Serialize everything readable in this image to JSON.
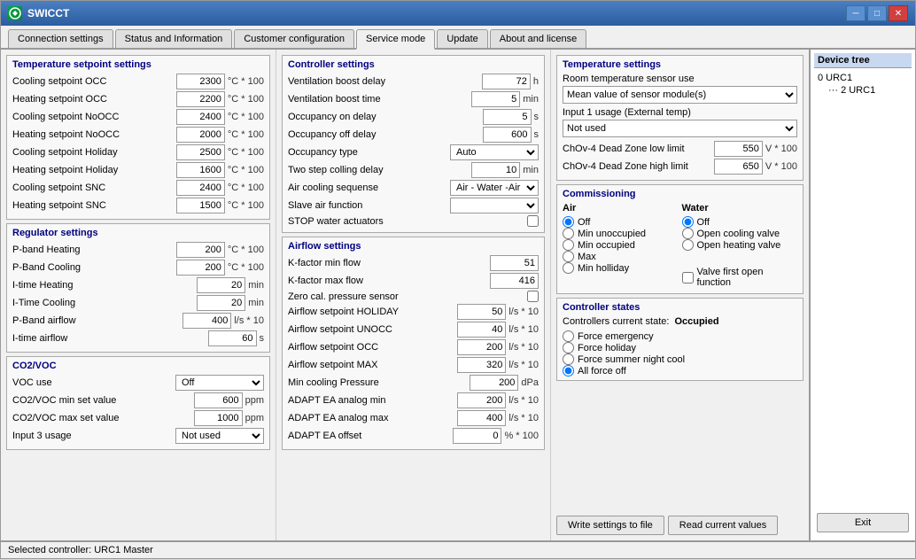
{
  "window": {
    "title": "SWICCT",
    "icon": "SW"
  },
  "tabs": [
    {
      "label": "Connection settings",
      "active": false
    },
    {
      "label": "Status and Information",
      "active": false
    },
    {
      "label": "Customer configuration",
      "active": false
    },
    {
      "label": "Service mode",
      "active": true
    },
    {
      "label": "Update",
      "active": false
    },
    {
      "label": "About and license",
      "active": false
    }
  ],
  "device_tree": {
    "title": "Device tree",
    "nodes": [
      {
        "label": "0 URC1",
        "level": 1
      },
      {
        "label": "2 URC1",
        "level": 2
      }
    ]
  },
  "temperature_setpoints": {
    "title": "Temperature setpoint settings",
    "fields": [
      {
        "label": "Cooling setpoint OCC",
        "value": "2300",
        "unit": "°C * 100"
      },
      {
        "label": "Heating setpoint OCC",
        "value": "2200",
        "unit": "°C * 100"
      },
      {
        "label": "Cooling setpoint NoOCC",
        "value": "2400",
        "unit": "°C * 100"
      },
      {
        "label": "Heating setpoint NoOCC",
        "value": "2000",
        "unit": "°C * 100"
      },
      {
        "label": "Cooling setpoint Holiday",
        "value": "2500",
        "unit": "°C * 100"
      },
      {
        "label": "Heating setpoint Holiday",
        "value": "1600",
        "unit": "°C * 100"
      },
      {
        "label": "Cooling setpoint SNC",
        "value": "2400",
        "unit": "°C * 100"
      },
      {
        "label": "Heating setpoint SNC",
        "value": "1500",
        "unit": "°C * 100"
      }
    ]
  },
  "regulator_settings": {
    "title": "Regulator settings",
    "fields": [
      {
        "label": "P-band Heating",
        "value": "200",
        "unit": "°C * 100"
      },
      {
        "label": "P-Band Cooling",
        "value": "200",
        "unit": "°C * 100"
      },
      {
        "label": "I-time Heating",
        "value": "20",
        "unit": "min"
      },
      {
        "label": "I-Time Cooling",
        "value": "20",
        "unit": "min"
      },
      {
        "label": "P-Band airflow",
        "value": "400",
        "unit": "l/s * 10"
      },
      {
        "label": "I-time airflow",
        "value": "60",
        "unit": "s"
      }
    ]
  },
  "co2_voc": {
    "title": "CO2/VOC",
    "fields": [
      {
        "label": "VOC use",
        "value": "Off",
        "type": "dropdown"
      },
      {
        "label": "CO2/VOC min set value",
        "value": "600",
        "unit": "ppm"
      },
      {
        "label": "CO2/VOC max set value",
        "value": "1000",
        "unit": "ppm"
      },
      {
        "label": "Input 3 usage",
        "value": "Not used",
        "type": "dropdown"
      }
    ]
  },
  "controller_settings": {
    "title": "Controller settings",
    "fields": [
      {
        "label": "Ventilation boost delay",
        "value": "72",
        "unit": "h"
      },
      {
        "label": "Ventilation boost time",
        "value": "5",
        "unit": "min"
      },
      {
        "label": "Occupancy on delay",
        "value": "5",
        "unit": "s"
      },
      {
        "label": "Occupancy off delay",
        "value": "600",
        "unit": "s"
      },
      {
        "label": "Occupancy type",
        "value": "Auto",
        "type": "dropdown"
      },
      {
        "label": "Two step colling delay",
        "value": "10",
        "unit": "min"
      },
      {
        "label": "Air cooling sequense",
        "value": "Air - Water -Air",
        "type": "dropdown"
      },
      {
        "label": "Slave air function",
        "value": "",
        "type": "dropdown"
      },
      {
        "label": "STOP water actuators",
        "value": false,
        "type": "checkbox"
      }
    ]
  },
  "airflow_settings": {
    "title": "Airflow settings",
    "fields": [
      {
        "label": "K-factor min flow",
        "value": "51"
      },
      {
        "label": "K-factor max flow",
        "value": "416"
      },
      {
        "label": "Zero cal. pressure sensor",
        "value": false,
        "type": "checkbox"
      },
      {
        "label": "Airflow setpoint HOLIDAY",
        "value": "50",
        "unit": "l/s * 10"
      },
      {
        "label": "Airflow setpoint UNOCC",
        "value": "40",
        "unit": "l/s * 10"
      },
      {
        "label": "Airflow setpoint OCC",
        "value": "200",
        "unit": "l/s * 10"
      },
      {
        "label": "Airflow setpoint MAX",
        "value": "320",
        "unit": "l/s * 10"
      },
      {
        "label": "Min cooling Pressure",
        "value": "200",
        "unit": "dPa"
      },
      {
        "label": "ADAPT EA analog min",
        "value": "200",
        "unit": "l/s * 10"
      },
      {
        "label": "ADAPT EA analog max",
        "value": "400",
        "unit": "l/s * 10"
      },
      {
        "label": "ADAPT EA offset",
        "value": "0",
        "unit": "% * 100"
      }
    ]
  },
  "temperature_settings": {
    "title": "Temperature settings",
    "room_temp_label": "Room temperature sensor use",
    "room_temp_value": "Mean value of sensor module(s)",
    "input1_label": "Input 1 usage (External temp)",
    "input1_value": "Not used",
    "dead_zone_low_label": "ChOv-4 Dead Zone low limit",
    "dead_zone_low_value": "550",
    "dead_zone_low_unit": "V * 100",
    "dead_zone_high_label": "ChOv-4 Dead Zone high limit",
    "dead_zone_high_value": "650",
    "dead_zone_high_unit": "V * 100"
  },
  "commissioning": {
    "title": "Commissioning",
    "air_title": "Air",
    "water_title": "Water",
    "air_options": [
      {
        "label": "Off",
        "selected": true
      },
      {
        "label": "Min unoccupied",
        "selected": false
      },
      {
        "label": "Min occupied",
        "selected": false
      },
      {
        "label": "Max",
        "selected": false
      },
      {
        "label": "Min holliday",
        "selected": false
      }
    ],
    "water_options": [
      {
        "label": "Off",
        "selected": true
      },
      {
        "label": "Open cooling valve",
        "selected": false
      },
      {
        "label": "Open heating valve",
        "selected": false
      }
    ],
    "valve_first_open": "Valve first open function"
  },
  "controller_states": {
    "title": "Controller states",
    "current_state_label": "Controllers current state:",
    "current_state_value": "Occupied",
    "states": [
      {
        "label": "Force emergency",
        "selected": false
      },
      {
        "label": "Force holiday",
        "selected": false
      },
      {
        "label": "Force summer night cool",
        "selected": false
      },
      {
        "label": "All force off",
        "selected": true
      }
    ]
  },
  "bottom_buttons": {
    "write_label": "Write settings to file",
    "read_label": "Read current values",
    "exit_label": "Exit"
  },
  "status_bar": {
    "text": "Selected controller: URC1 Master"
  }
}
